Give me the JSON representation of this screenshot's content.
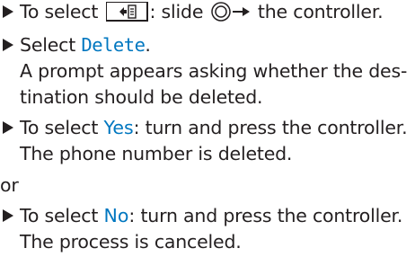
{
  "steps": [
    {
      "pre": "To select ",
      "mid": ": slide ",
      "post": " the controller."
    },
    {
      "pre": "Select ",
      "cmd": "Delete",
      "post": ".",
      "result_1": "A prompt appears asking whether the des-",
      "result_2": "tination should be deleted."
    },
    {
      "pre": "To select ",
      "cmd": "Yes",
      "post": ": turn and press the controller.",
      "result_1": "The phone number is deleted."
    },
    {
      "pre": "To select ",
      "cmd": "No",
      "post": ": turn and press the controller.",
      "result_1": "The process is canceled."
    }
  ],
  "separator": "or",
  "colors": {
    "text": "#231f20",
    "command": "#0077c0"
  },
  "icons": {
    "menu_key": "menu-key-icon",
    "controller": "controller-slide-right-icon",
    "bullet": "triangle-bullet-icon"
  }
}
